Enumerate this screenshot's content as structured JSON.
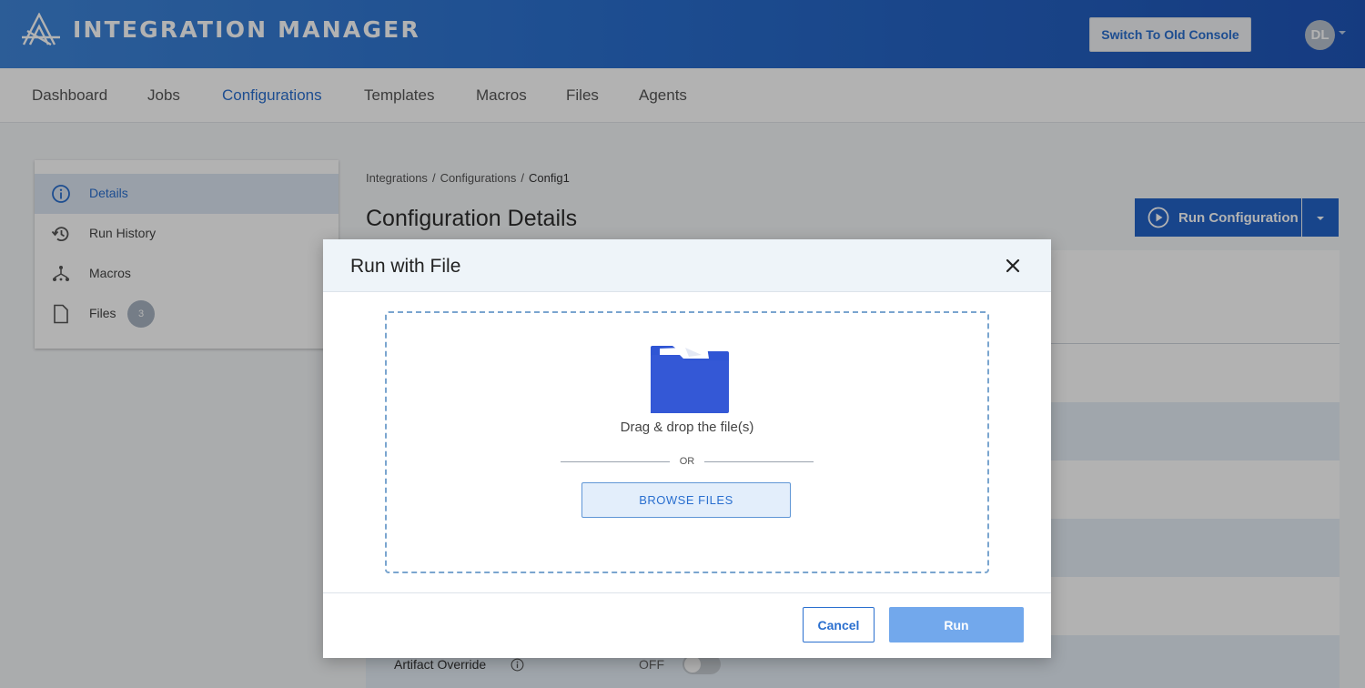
{
  "header": {
    "app_title": "INTEGRATION MANAGER",
    "logo_icon": "mountain-logo-icon",
    "switch_console_label": "Switch To Old Console",
    "avatar_initials": "DL"
  },
  "nav": {
    "items": [
      {
        "label": "Dashboard"
      },
      {
        "label": "Jobs"
      },
      {
        "label": "Configurations",
        "active": true
      },
      {
        "label": "Templates"
      },
      {
        "label": "Macros"
      },
      {
        "label": "Files"
      },
      {
        "label": "Agents"
      }
    ]
  },
  "sidebar": {
    "items": [
      {
        "label": "Details",
        "icon": "info-icon",
        "active": true
      },
      {
        "label": "Run History",
        "icon": "history-icon"
      },
      {
        "label": "Macros",
        "icon": "macros-icon"
      },
      {
        "label": "Files",
        "icon": "file-icon",
        "badge": "3"
      }
    ]
  },
  "main": {
    "breadcrumb": [
      "Integrations",
      "Configurations",
      "Config1"
    ],
    "title": "Configuration Details",
    "run_config_label": "Run Configuration",
    "artifact_override": {
      "label": "Artifact Override",
      "state": "OFF"
    }
  },
  "modal": {
    "title": "Run with File",
    "drop_text": "Drag & drop the file(s)",
    "or_text": "OR",
    "browse_label": "BROWSE FILES",
    "cancel_label": "Cancel",
    "run_label": "Run"
  },
  "colors": {
    "brand_blue": "#2a6fcf",
    "header_gradient_start": "#3f86d9",
    "header_gradient_end": "#1f55b8",
    "primary_button": "#2364c8",
    "disabled_run": "#72a8ec",
    "folder": "#2f55d4"
  }
}
